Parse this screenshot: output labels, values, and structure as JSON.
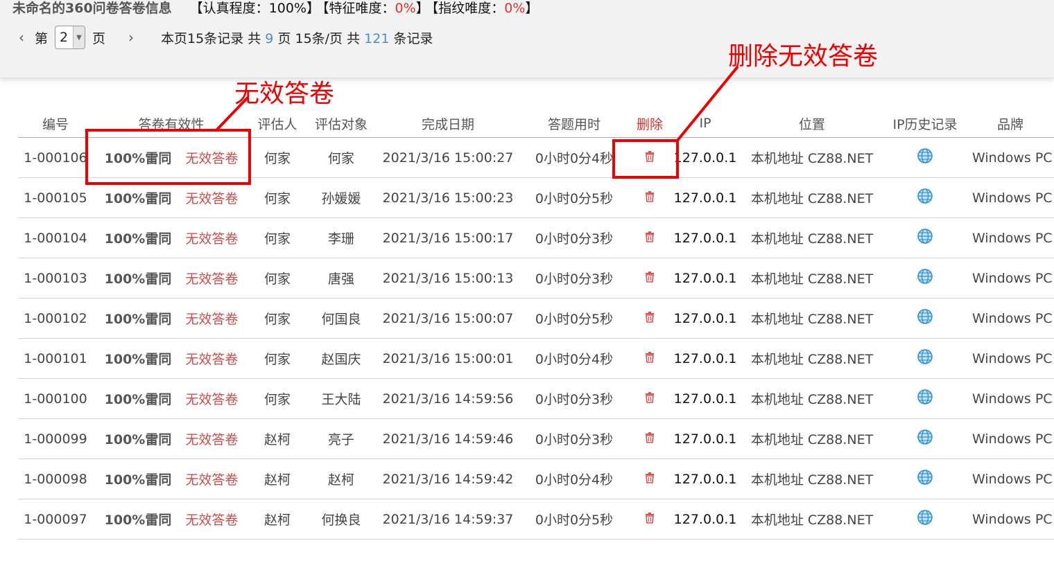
{
  "header": {
    "survey_title": "未命名的360问卷答卷信息",
    "metrics": [
      {
        "label": "【认真程度：",
        "value": "100%",
        "suffix": "】",
        "value_color": "#111111"
      },
      {
        "label": "【特征唯度：",
        "value": "0%",
        "suffix": "】",
        "value_color": "#e03030"
      },
      {
        "label": "【指纹唯度：",
        "value": "0%",
        "suffix": "】",
        "value_color": "#e03030"
      }
    ]
  },
  "pager": {
    "prev_icon": "chevron-left-icon",
    "next_icon": "chevron-right-icon",
    "page_prefix": "第",
    "current_page": "2",
    "page_suffix": "页",
    "info_text_1": "本页15条记录 共",
    "total_pages": "9",
    "info_text_2": "页 15条/页 共",
    "total_records": "121",
    "info_text_3": "条记录"
  },
  "table": {
    "columns": [
      "编号",
      "答卷有效性",
      "评估人",
      "评估对象",
      "完成日期",
      "答题用时",
      "删除",
      "IP",
      "位置",
      "IP历史记录",
      "品牌"
    ],
    "rows": [
      {
        "id": "1-000106",
        "validity": "100%雷同",
        "invalid_label": "无效答卷",
        "evaluator": "何家",
        "target": "何家",
        "date": "2021/3/16 15:00:27",
        "duration": "0小时0分4秒",
        "ip": "127.0.0.1",
        "location": "本机地址 CZ88.NET",
        "brand": "Windows PC"
      },
      {
        "id": "1-000105",
        "validity": "100%雷同",
        "invalid_label": "无效答卷",
        "evaluator": "何家",
        "target": "孙媛媛",
        "date": "2021/3/16 15:00:23",
        "duration": "0小时0分5秒",
        "ip": "127.0.0.1",
        "location": "本机地址 CZ88.NET",
        "brand": "Windows PC"
      },
      {
        "id": "1-000104",
        "validity": "100%雷同",
        "invalid_label": "无效答卷",
        "evaluator": "何家",
        "target": "李珊",
        "date": "2021/3/16 15:00:17",
        "duration": "0小时0分3秒",
        "ip": "127.0.0.1",
        "location": "本机地址 CZ88.NET",
        "brand": "Windows PC"
      },
      {
        "id": "1-000103",
        "validity": "100%雷同",
        "invalid_label": "无效答卷",
        "evaluator": "何家",
        "target": "唐强",
        "date": "2021/3/16 15:00:13",
        "duration": "0小时0分3秒",
        "ip": "127.0.0.1",
        "location": "本机地址 CZ88.NET",
        "brand": "Windows PC"
      },
      {
        "id": "1-000102",
        "validity": "100%雷同",
        "invalid_label": "无效答卷",
        "evaluator": "何家",
        "target": "何国良",
        "date": "2021/3/16 15:00:07",
        "duration": "0小时0分5秒",
        "ip": "127.0.0.1",
        "location": "本机地址 CZ88.NET",
        "brand": "Windows PC"
      },
      {
        "id": "1-000101",
        "validity": "100%雷同",
        "invalid_label": "无效答卷",
        "evaluator": "何家",
        "target": "赵国庆",
        "date": "2021/3/16 15:00:01",
        "duration": "0小时0分4秒",
        "ip": "127.0.0.1",
        "location": "本机地址 CZ88.NET",
        "brand": "Windows PC"
      },
      {
        "id": "1-000100",
        "validity": "100%雷同",
        "invalid_label": "无效答卷",
        "evaluator": "何家",
        "target": "王大陆",
        "date": "2021/3/16 14:59:56",
        "duration": "0小时0分3秒",
        "ip": "127.0.0.1",
        "location": "本机地址 CZ88.NET",
        "brand": "Windows PC"
      },
      {
        "id": "1-000099",
        "validity": "100%雷同",
        "invalid_label": "无效答卷",
        "evaluator": "赵柯",
        "target": "亮子",
        "date": "2021/3/16 14:59:46",
        "duration": "0小时0分3秒",
        "ip": "127.0.0.1",
        "location": "本机地址 CZ88.NET",
        "brand": "Windows PC"
      },
      {
        "id": "1-000098",
        "validity": "100%雷同",
        "invalid_label": "无效答卷",
        "evaluator": "赵柯",
        "target": "赵柯",
        "date": "2021/3/16 14:59:42",
        "duration": "0小时0分4秒",
        "ip": "127.0.0.1",
        "location": "本机地址 CZ88.NET",
        "brand": "Windows PC"
      },
      {
        "id": "1-000097",
        "validity": "100%雷同",
        "invalid_label": "无效答卷",
        "evaluator": "赵柯",
        "target": "何换良",
        "date": "2021/3/16 14:59:37",
        "duration": "0小时0分5秒",
        "ip": "127.0.0.1",
        "location": "本机地址 CZ88.NET",
        "brand": "Windows PC"
      }
    ],
    "delete_icon": "trash-icon",
    "history_icon": "globe-icon"
  },
  "annotations": {
    "invalid_callout": "无效答卷",
    "delete_callout": "删除无效答卷",
    "color": "#ee0000"
  }
}
